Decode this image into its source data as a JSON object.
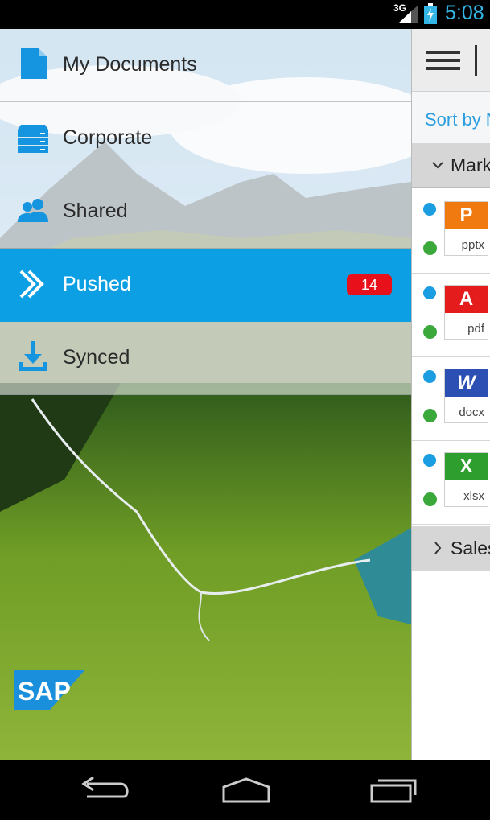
{
  "status_bar": {
    "network": "3G",
    "time": "5:08",
    "accent_color": "#33b5e5"
  },
  "drawer": {
    "items": [
      {
        "label": "My Documents",
        "icon": "document-icon",
        "selected": false
      },
      {
        "label": "Corporate",
        "icon": "server-icon",
        "selected": false
      },
      {
        "label": "Shared",
        "icon": "people-icon",
        "selected": false
      },
      {
        "label": "Pushed",
        "icon": "push-arrow-icon",
        "selected": true,
        "badge": "14"
      },
      {
        "label": "Synced",
        "icon": "download-icon",
        "selected": false
      }
    ],
    "selected_color": "#0d9fe3",
    "badge_color": "#e8101a",
    "logo": "SAP"
  },
  "content": {
    "sort_label": "Sort by N",
    "groups": [
      {
        "label": "Mark",
        "expanded": true
      },
      {
        "label": "Sales",
        "expanded": false
      }
    ],
    "files": [
      {
        "ext": "pptx",
        "type_icon": "powerpoint-icon",
        "color": "#f07a10",
        "glyph": "P"
      },
      {
        "ext": "pdf",
        "type_icon": "pdf-icon",
        "color": "#e51c1c",
        "glyph": "A"
      },
      {
        "ext": "docx",
        "type_icon": "word-icon",
        "color": "#2c4fb3",
        "glyph": "W"
      },
      {
        "ext": "xlsx",
        "type_icon": "excel-icon",
        "color": "#2e9e2e",
        "glyph": "X"
      }
    ]
  },
  "nav_bar": {
    "buttons": [
      "back",
      "home",
      "recents"
    ]
  }
}
